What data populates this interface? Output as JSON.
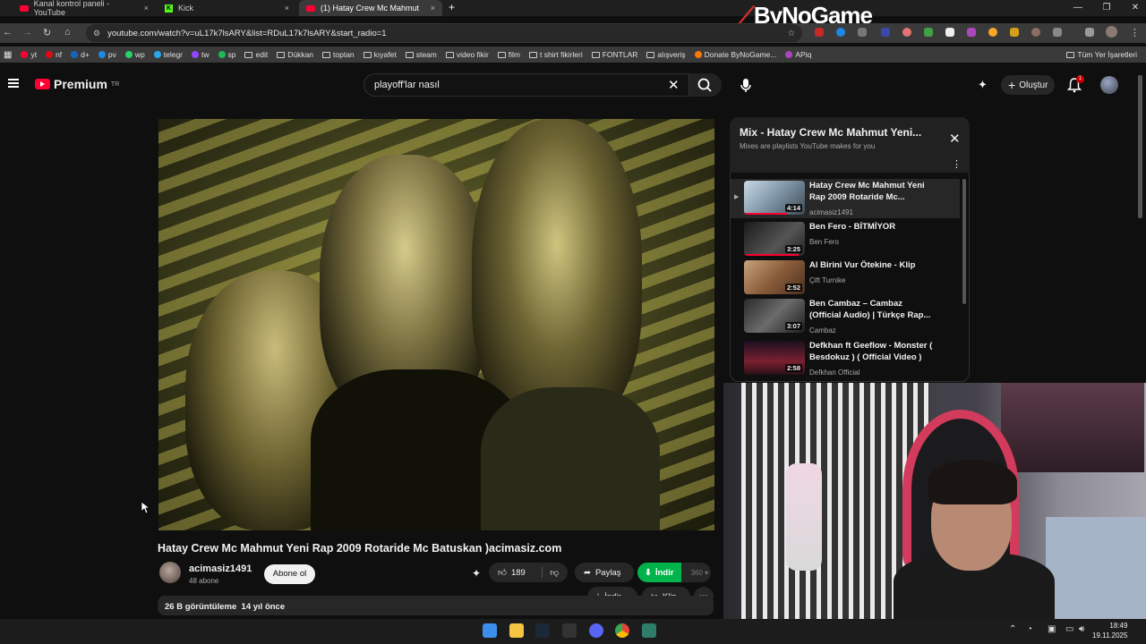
{
  "browser": {
    "tabs": [
      {
        "label": "Kanal kontrol paneli - YouTube",
        "close": "×"
      },
      {
        "label": "Kick",
        "close": "×"
      },
      {
        "label": "(1) Hatay Crew Mc Mahmut",
        "close": "×"
      }
    ],
    "new_tab": "+",
    "url": "youtube.com/watch?v=uL17k7lsARY&list=RDuL17k7lsARY&start_radio=1",
    "bookmarks": [
      "yt",
      "nf",
      "d+",
      "pv",
      "wp",
      "telegr",
      "tw",
      "sp",
      "edit",
      "Dükkan",
      "toptan",
      "kıyafet",
      "steam",
      "video fikir",
      "film",
      "t shirt fikirleri",
      "FONTLAR",
      "alışveriş",
      "Donate ByNoGame...",
      "APiq"
    ],
    "all_bookmarks": "Tüm Yer İşaretleri",
    "window_controls": [
      "—",
      "❐",
      "✕"
    ]
  },
  "overlay": {
    "brand": "ByNoGame"
  },
  "youtube": {
    "logo": "Premium",
    "logo_region": "TR",
    "search_value": "playoff'lar nasıl",
    "create_label": "Oluştur",
    "notification_count": "1"
  },
  "video": {
    "title": "Hatay Crew Mc Mahmut Yeni Rap 2009 Rotaride Mc Batuskan )acimasiz.com",
    "channel": "acimasiz1491",
    "subscribers": "48 abone",
    "subscribe_label": "Abone ol",
    "likes": "189",
    "share_label": "Paylaş",
    "download_label": "İndir",
    "download_quality": "360",
    "download2_label": "İndir",
    "clip_label": "Klip",
    "views": "26 B görüntüleme",
    "age": "14 yıl önce"
  },
  "mix": {
    "title": "Mix - Hatay Crew Mc Mahmut Yeni...",
    "subtitle": "Mixes are playlists YouTube makes for you",
    "items": [
      {
        "title": "Hatay Crew Mc Mahmut Yeni Rap 2009 Rotaride Mc...",
        "channel": "acimasiz1491",
        "duration": "4:14"
      },
      {
        "title": "Ben Fero - BİTMİYOR",
        "channel": "Ben Fero",
        "duration": "3:25"
      },
      {
        "title": "Al Birini Vur Ötekine - Klip",
        "channel": "Çift Turnike",
        "duration": "2:52"
      },
      {
        "title": "Ben Cambaz – Cambaz (Official Audio) | Türkçe Rap...",
        "channel": "Cambaz",
        "duration": "3:07"
      },
      {
        "title": "Defkhan ft Geeflow - Monster ( Besdokuz ) ( Official Video )",
        "channel": "Defkhan Official",
        "duration": "2:58"
      }
    ]
  },
  "taskbar": {
    "time": "18:49",
    "date": "19.11.2025"
  },
  "colors": {
    "yt_red": "#ff0033",
    "download_green": "#00b34a",
    "background": "#0f0f0f"
  }
}
